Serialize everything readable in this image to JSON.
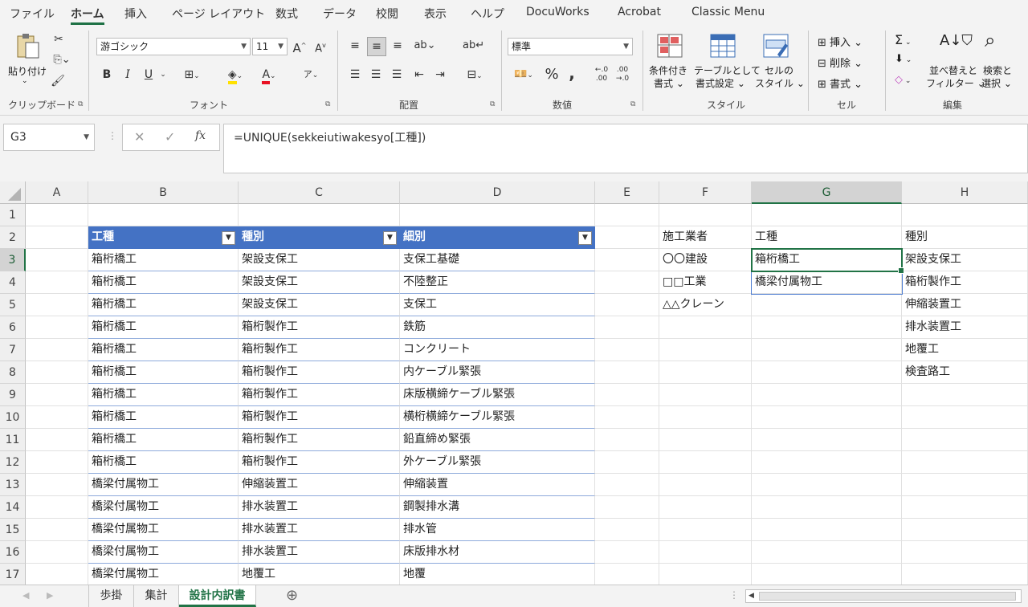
{
  "menu": [
    "ファイル",
    "ホーム",
    "挿入",
    "ページ レイアウト",
    "数式",
    "データ",
    "校閲",
    "表示",
    "ヘルプ",
    "DocuWorks",
    "Acrobat",
    "Classic Menu"
  ],
  "ribbon": {
    "clipboard": {
      "label": "クリップボード",
      "paste": "貼り付け"
    },
    "font": {
      "label": "フォント",
      "name": "游ゴシック",
      "size": "11",
      "grow": "A",
      "shrink": "A",
      "bold": "B",
      "italic": "I",
      "underline": "U"
    },
    "align": {
      "label": "配置"
    },
    "number": {
      "label": "数値",
      "format": "標準",
      "percent": "%",
      "comma": ","
    },
    "style": {
      "label": "スタイル",
      "cond1": "条件付き",
      "cond2": "書式",
      "table1": "テーブルとして",
      "table2": "書式設定",
      "cell1": "セルの",
      "cell2": "スタイル"
    },
    "cells": {
      "label": "セル",
      "insert": "挿入",
      "delete": "削除",
      "format": "書式"
    },
    "edit": {
      "label": "編集",
      "sigma": "Σ",
      "sort1": "並べ替えと",
      "sort2": "フィルター",
      "find1": "検索と",
      "find2": "選択"
    }
  },
  "formula_bar": {
    "name_box": "G3",
    "cancel": "✕",
    "enter": "✓",
    "fx": "fx",
    "formula": "=UNIQUE(sekkeiutiwakesyo[工種])"
  },
  "columns": [
    "A",
    "B",
    "C",
    "D",
    "E",
    "F",
    "G",
    "H"
  ],
  "rows": [
    "1",
    "2",
    "3",
    "4",
    "5",
    "6",
    "7",
    "8",
    "9",
    "10",
    "11",
    "12",
    "13",
    "14",
    "15",
    "16",
    "17"
  ],
  "table": {
    "headers": [
      "工種",
      "種別",
      "細別"
    ],
    "rows": [
      [
        "箱桁橋工",
        "架設支保工",
        "支保工基礎"
      ],
      [
        "箱桁橋工",
        "架設支保工",
        "不陸整正"
      ],
      [
        "箱桁橋工",
        "架設支保工",
        "支保工"
      ],
      [
        "箱桁橋工",
        "箱桁製作工",
        "鉄筋"
      ],
      [
        "箱桁橋工",
        "箱桁製作工",
        "コンクリート"
      ],
      [
        "箱桁橋工",
        "箱桁製作工",
        "内ケーブル緊張"
      ],
      [
        "箱桁橋工",
        "箱桁製作工",
        "床版横締ケーブル緊張"
      ],
      [
        "箱桁橋工",
        "箱桁製作工",
        "横桁横締ケーブル緊張"
      ],
      [
        "箱桁橋工",
        "箱桁製作工",
        "鉛直締め緊張"
      ],
      [
        "箱桁橋工",
        "箱桁製作工",
        "外ケーブル緊張"
      ],
      [
        "橋梁付属物工",
        "伸縮装置工",
        "伸縮装置"
      ],
      [
        "橋梁付属物工",
        "排水装置工",
        "鋼製排水溝"
      ],
      [
        "橋梁付属物工",
        "排水装置工",
        "排水管"
      ],
      [
        "橋梁付属物工",
        "排水装置工",
        "床版排水材"
      ],
      [
        "橋梁付属物工",
        "地覆工",
        "地覆"
      ]
    ]
  },
  "side_lists": {
    "F": [
      "施工業者",
      "〇〇建設",
      "□□工業",
      "△△クレーン"
    ],
    "G": [
      "工種",
      "箱桁橋工",
      "橋梁付属物工"
    ],
    "H": [
      "種別",
      "架設支保工",
      "箱桁製作工",
      "伸縮装置工",
      "排水装置工",
      "地覆工",
      "検査路工"
    ]
  },
  "sheet_tabs": [
    "歩掛",
    "集計",
    "設計内訳書"
  ],
  "active_sheet": "設計内訳書",
  "add_sheet": "⊕"
}
